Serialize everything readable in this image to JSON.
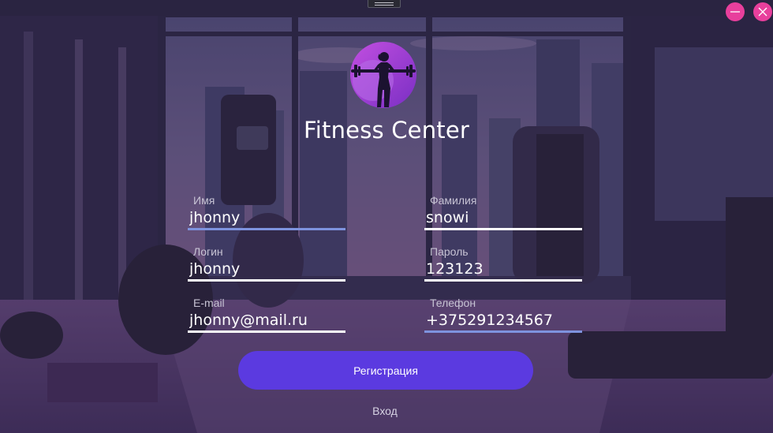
{
  "app": {
    "title": "Fitness Center",
    "logo_icon": "fitness-woman-barbell-icon",
    "accent_color": "#5b3ae0",
    "window_button_color": "#e83f9c"
  },
  "window_controls": {
    "minimize_icon": "minimize-icon",
    "close_icon": "close-icon"
  },
  "form": {
    "first_name": {
      "label": "Имя",
      "value": "jhonny"
    },
    "last_name": {
      "label": "Фамилия",
      "value": "snowi"
    },
    "login": {
      "label": "Логин",
      "value": "jhonny"
    },
    "password": {
      "label": "Пароль",
      "value": "123123"
    },
    "email": {
      "label": "E-mail",
      "value": "jhonny@mail.ru"
    },
    "phone": {
      "label": "Телефон",
      "value": "+375291234567"
    }
  },
  "actions": {
    "register_label": "Регистрация",
    "login_label": "Вход"
  }
}
